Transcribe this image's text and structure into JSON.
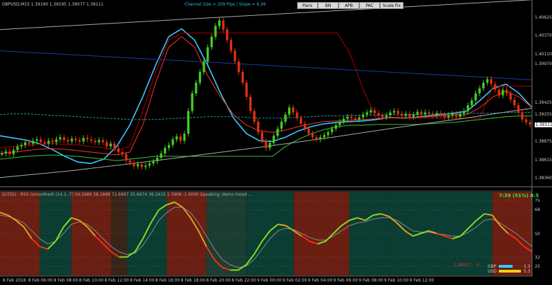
{
  "chart_data": [
    {
      "type": "candlestick",
      "title": "GBPUSD,M15  1.39190 1.39195 1.39077 1.39111",
      "subtitle": "Channel Size = 209 Pips  |  Slope = 6.26",
      "price_ticks": [
        "1.40625",
        "1.40370",
        "1.40110",
        "1.39970",
        "1.39425",
        "1.39255",
        "1.39111",
        "1.38875",
        "1.38615",
        "1.38360"
      ],
      "current_price": "1.39111",
      "ylim": [
        1.3825,
        1.4075
      ],
      "close": [
        1.387,
        1.3873,
        1.3869,
        1.3875,
        1.388,
        1.3882,
        1.3886,
        1.3884,
        1.3888,
        1.389,
        1.3886,
        1.3884,
        1.3888,
        1.3886,
        1.389,
        1.3893,
        1.3889,
        1.3887,
        1.3891,
        1.3889,
        1.3887,
        1.3892,
        1.389,
        1.3888,
        1.3886,
        1.3889,
        1.3886,
        1.388,
        1.3884,
        1.3877,
        1.3872,
        1.3869,
        1.386,
        1.3857,
        1.3852,
        1.3855,
        1.3851,
        1.3853,
        1.3856,
        1.3859,
        1.3864,
        1.387,
        1.3878,
        1.3882,
        1.389,
        1.3894,
        1.3888,
        1.3898,
        1.393,
        1.3955,
        1.397,
        1.3985,
        1.4,
        1.402,
        1.4035,
        1.405,
        1.4058,
        1.4045,
        1.403,
        1.4015,
        1.4,
        1.3985,
        1.397,
        1.395,
        1.393,
        1.3915,
        1.39,
        1.3888,
        1.3878,
        1.3885,
        1.3895,
        1.3905,
        1.3915,
        1.3925,
        1.3935,
        1.3928,
        1.392,
        1.3912,
        1.3905,
        1.3898,
        1.3893,
        1.389,
        1.3893,
        1.3896,
        1.39,
        1.3905,
        1.391,
        1.3915,
        1.3919,
        1.3922,
        1.392,
        1.3918,
        1.3921,
        1.3925,
        1.3928,
        1.3931,
        1.3927,
        1.3924,
        1.3921,
        1.3924,
        1.3928,
        1.393,
        1.3926,
        1.3923,
        1.3926,
        1.3922,
        1.3925,
        1.3929,
        1.3925,
        1.3928,
        1.3926,
        1.3924,
        1.3927,
        1.3925,
        1.3921,
        1.3924,
        1.3926,
        1.3922,
        1.3926,
        1.393,
        1.3938,
        1.3945,
        1.3955,
        1.3962,
        1.397,
        1.3975,
        1.3968,
        1.396,
        1.3952,
        1.396,
        1.3955,
        1.3946,
        1.3938,
        1.3928,
        1.3918,
        1.3914,
        1.3911
      ],
      "lines": [
        {
          "name": "cyan-ma",
          "color": "#3ec8ff",
          "values": [
            1.3895,
            1.3892,
            1.3889,
            1.3884,
            1.3876,
            1.3866,
            1.3858,
            1.3856,
            1.3862,
            1.388,
            1.391,
            1.395,
            1.3995,
            1.4035,
            1.4046,
            1.403,
            1.3995,
            1.3955,
            1.392,
            1.3898,
            1.3888,
            1.3887,
            1.3893,
            1.3902,
            1.3908,
            1.3912,
            1.3914,
            1.3915,
            1.3916,
            1.3918,
            1.3921,
            1.392,
            1.3921,
            1.3923,
            1.3925,
            1.3927,
            1.393,
            1.3945,
            1.3962,
            1.3968,
            1.3955,
            1.3935
          ]
        },
        {
          "name": "dark-red-line",
          "color": "#b00000",
          "values": [
            1.3878,
            1.388,
            1.3882,
            1.3883,
            1.3884,
            1.3883,
            1.3882,
            1.388,
            1.3878,
            1.3875,
            1.388,
            1.393,
            1.3985,
            1.403,
            1.404,
            1.404,
            1.404,
            1.404,
            1.404,
            1.404,
            1.404,
            1.404,
            1.404,
            1.404,
            1.404,
            1.404,
            1.404,
            1.401,
            1.396,
            1.392,
            1.392,
            1.392,
            1.392,
            1.392,
            1.392,
            1.392,
            1.392,
            1.392,
            1.3965,
            1.3965,
            1.3965,
            1.3965
          ]
        },
        {
          "name": "red-line",
          "color": "#ff3030",
          "values": [
            1.387,
            1.3872,
            1.3874,
            1.3876,
            1.3877,
            1.3876,
            1.3874,
            1.3872,
            1.387,
            1.3868,
            1.3872,
            1.391,
            1.397,
            1.402,
            1.4035,
            1.402,
            1.398,
            1.395,
            1.3925,
            1.391,
            1.3902,
            1.39,
            1.3903,
            1.3908,
            1.3912,
            1.3915,
            1.3916,
            1.3917,
            1.3918,
            1.3919,
            1.3921,
            1.392,
            1.3921,
            1.3922,
            1.3923,
            1.3924,
            1.3925,
            1.3935,
            1.395,
            1.3958,
            1.395,
            1.3935
          ]
        },
        {
          "name": "green-line",
          "color": "#38c838",
          "values": [
            1.3862,
            1.3864,
            1.3866,
            1.3867,
            1.3868,
            1.3867,
            1.3866,
            1.3864,
            1.3862,
            1.386,
            1.3862,
            1.3864,
            1.3866,
            1.3866,
            1.3866,
            1.3866,
            1.3866,
            1.3866,
            1.3866,
            1.3866,
            1.3866,
            1.3866,
            1.388,
            1.389,
            1.3898,
            1.3904,
            1.3908,
            1.391,
            1.391,
            1.3911,
            1.3911,
            1.3911,
            1.3911,
            1.3912,
            1.3913,
            1.3914,
            1.3916,
            1.3918,
            1.392,
            1.3922,
            1.3923,
            1.3923
          ]
        },
        {
          "name": "blue-line",
          "color": "#1a3aa0",
          "values": [
            1.4015,
            1.4014,
            1.4013,
            1.4012,
            1.4011,
            1.401,
            1.4009,
            1.4008,
            1.4007,
            1.4006,
            1.4005,
            1.4004,
            1.4003,
            1.4002,
            1.4001,
            1.4,
            1.3999,
            1.3998,
            1.3997,
            1.3996,
            1.3995,
            1.3994,
            1.3993,
            1.3992,
            1.3991,
            1.399,
            1.3989,
            1.3988,
            1.3987,
            1.3986,
            1.3985,
            1.3984,
            1.3983,
            1.3982,
            1.3981,
            1.398,
            1.3979,
            1.3978,
            1.3977,
            1.3976,
            1.3975,
            1.3974
          ]
        },
        {
          "name": "teal-dash",
          "color": "#2a9a9a",
          "dashed": true,
          "values": [
            1.3925,
            1.3926,
            1.3926,
            1.3925,
            1.3924,
            1.3923,
            1.3922,
            1.3921,
            1.392,
            1.3919,
            1.3918,
            1.3918,
            1.3918,
            1.3919,
            1.392,
            1.3921,
            1.3922,
            1.3922,
            1.3922,
            1.3921,
            1.392,
            1.392,
            1.392,
            1.3921,
            1.3922,
            1.3923,
            1.3923,
            1.3924,
            1.3924,
            1.3924,
            1.3925,
            1.3925,
            1.3925,
            1.3926,
            1.3926,
            1.3926,
            1.3927,
            1.3927,
            1.3927,
            1.3928,
            1.3928,
            1.3928
          ]
        },
        {
          "name": "grey-channel-upper",
          "color": "#aaaaaa",
          "values": [
            1.4045,
            1.4052,
            1.4059,
            1.4066,
            1.4073,
            1.408,
            1.4087
          ]
        },
        {
          "name": "grey-channel-lower",
          "color": "#aaaaaa",
          "values": [
            1.3836,
            1.3845,
            1.3856,
            1.3868,
            1.388,
            1.3893,
            1.3907,
            1.392,
            1.3934
          ]
        }
      ]
    },
    {
      "type": "line",
      "title": "DzTDG - RSX (smoothed) (14,1,-7) 54.2989 38.1888 71.6997 35.6674 38.2415 1.3908 -1.0000  Speaking: demo mood ...",
      "subtitle": "7:39 (51%) 0.5",
      "yticks": [
        "75",
        "68",
        "50",
        "32",
        "25"
      ],
      "ylim": [
        18,
        82
      ],
      "x_labels": [
        "8 Feb 2018",
        "8 Feb 06:00",
        "8 Feb 08:00",
        "8 Feb 10:00",
        "8 Feb 12:00",
        "8 Feb 14:00",
        "8 Feb 16:00",
        "8 Feb 18:00",
        "8 Feb 20:00",
        "8 Feb 22:00",
        "9 Feb 00:00",
        "9 Feb 02:00",
        "9 Feb 04:00",
        "9 Feb 06:00",
        "9 Feb 08:00",
        "9 Feb 10:00",
        "9 Feb 12:00"
      ],
      "rsx": [
        66,
        64,
        60,
        55,
        46,
        40,
        38,
        44,
        55,
        62,
        60,
        55,
        48,
        42,
        36,
        32,
        32,
        36,
        46,
        58,
        68,
        72,
        74,
        70,
        62,
        52,
        40,
        30,
        24,
        22,
        22,
        26,
        34,
        44,
        52,
        57,
        56,
        52,
        48,
        44,
        42,
        44,
        50,
        56,
        60,
        62,
        60,
        64,
        65,
        63,
        58,
        52,
        48,
        50,
        52,
        50,
        48,
        46,
        48,
        54,
        60,
        65,
        64,
        56,
        50,
        46,
        40,
        36
      ],
      "signal": [
        64,
        63,
        61,
        58,
        52,
        46,
        42,
        44,
        50,
        57,
        59,
        57,
        52,
        46,
        40,
        36,
        34,
        35,
        41,
        50,
        60,
        66,
        70,
        70,
        66,
        58,
        48,
        38,
        30,
        26,
        24,
        25,
        30,
        38,
        46,
        52,
        54,
        53,
        50,
        47,
        45,
        45,
        48,
        52,
        56,
        58,
        59,
        61,
        62,
        62,
        60,
        56,
        52,
        51,
        51,
        50,
        49,
        48,
        48,
        51,
        55,
        60,
        61,
        58,
        54,
        50,
        45,
        40
      ],
      "zones": [
        {
          "until": 5,
          "color": "#6b1e12"
        },
        {
          "until": 9,
          "color": "#0b3d32"
        },
        {
          "until": 14,
          "color": "#6b1e12"
        },
        {
          "until": 16,
          "color": "#3a2418"
        },
        {
          "until": 21,
          "color": "#0b3d32"
        },
        {
          "until": 26,
          "color": "#6b1e12"
        },
        {
          "until": 31,
          "color": "#1a3e32"
        },
        {
          "until": 37,
          "color": "#0b3d32"
        },
        {
          "until": 44,
          "color": "#6b1e12"
        },
        {
          "until": 49,
          "color": "#0b3d32"
        },
        {
          "until": 56,
          "color": "#0b3d32"
        },
        {
          "until": 62,
          "color": "#0b3d32"
        },
        {
          "until": 68,
          "color": "#6b1e12"
        }
      ],
      "readout_price": "1.39577",
      "readout_zero": "0",
      "meter": [
        {
          "label": "GBP",
          "value": "1.3",
          "color": "#2ad0ff"
        },
        {
          "label": "USD",
          "value": "5.3",
          "color": "#e8d020"
        }
      ]
    }
  ],
  "toolbar": {
    "buttons": [
      "Pairs",
      "BN",
      "APB",
      "PAC",
      "Scale Fix"
    ]
  },
  "colors": {
    "bull": "#44cc22",
    "bear": "#e03010",
    "bg": "#000000",
    "axis": "#777777",
    "title_accent": "#20c0e0",
    "sub_accent": "#40e040"
  }
}
